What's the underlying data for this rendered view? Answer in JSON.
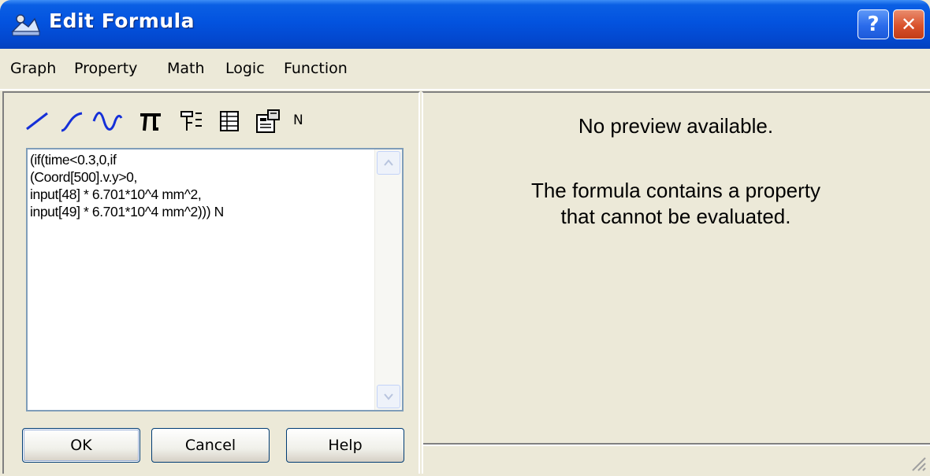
{
  "window": {
    "title": "Edit Formula",
    "help_glyph": "?",
    "close_glyph": "✕",
    "accent_color": "#0353DF"
  },
  "menu": {
    "items": [
      "Graph",
      "Property",
      "Math",
      "Logic",
      "Function"
    ]
  },
  "toolbar": {
    "icons": [
      "line-icon",
      "curve-icon",
      "wave-icon",
      "pi-icon",
      "property-tree-icon",
      "table-icon",
      "properties-icon"
    ],
    "units_label": "N"
  },
  "editor": {
    "text": "(if(time<0.3,0,if\n(Coord[500].v.y>0,\ninput[48] * 6.701*10^4 mm^2,\ninput[49] * 6.701*10^4 mm^2))) N"
  },
  "buttons": {
    "ok": "OK",
    "cancel": "Cancel",
    "help": "Help"
  },
  "preview": {
    "line1": "No preview available.",
    "line2": "The formula contains a property",
    "line3": "that cannot be evaluated."
  }
}
